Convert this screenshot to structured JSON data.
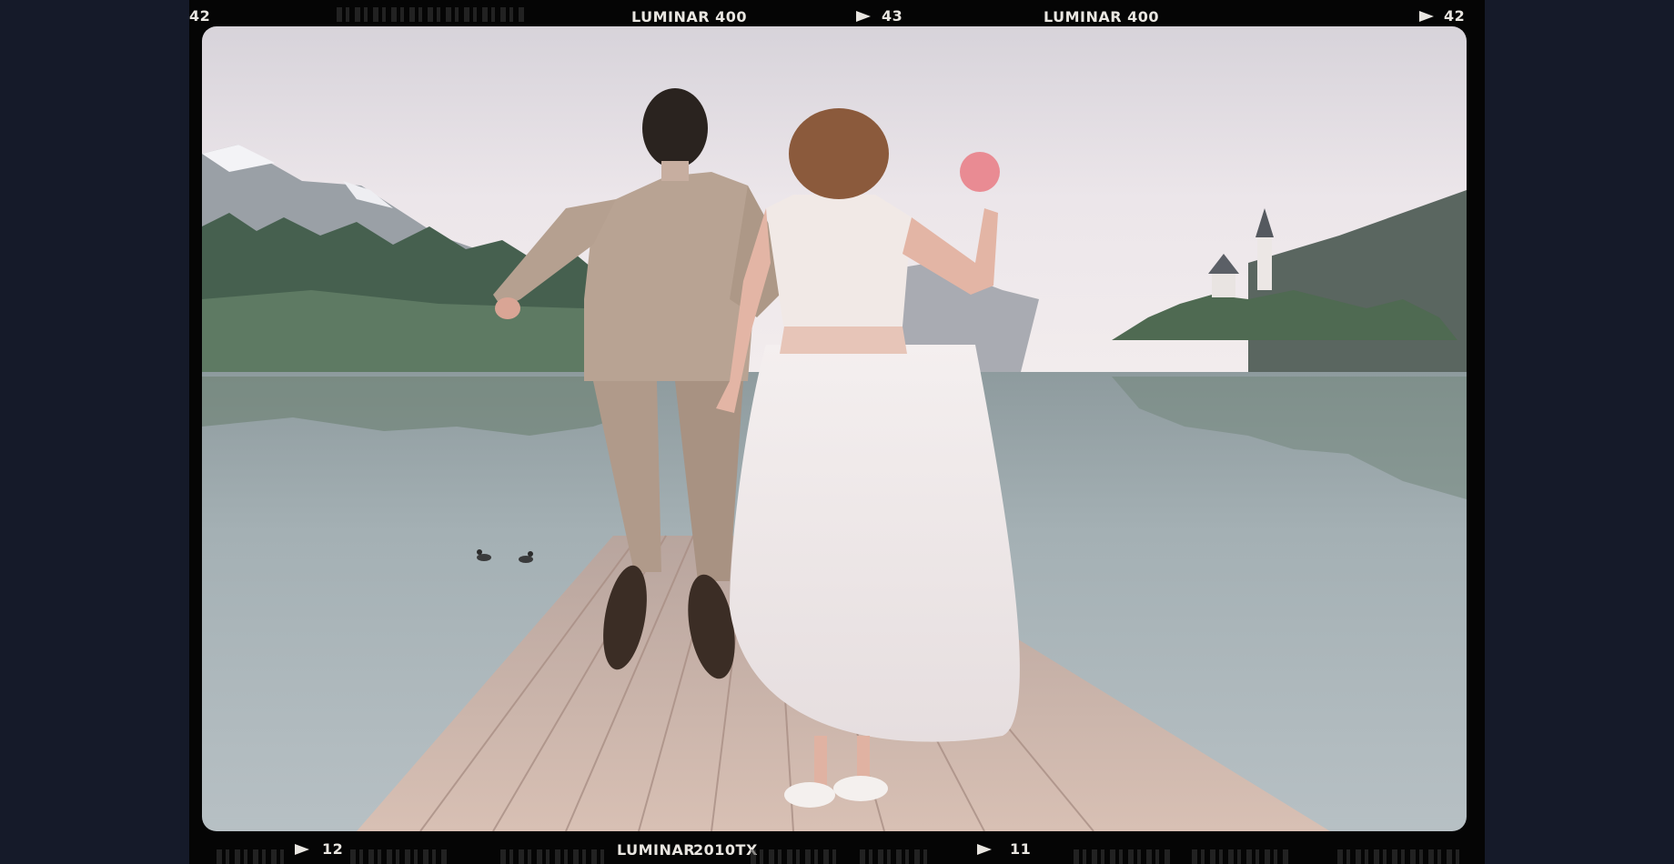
{
  "film_edge": {
    "top_frame_left": "42",
    "top_brand_1": "LUMINAR 400",
    "top_frame_mid": "43",
    "top_brand_2": "LUMINAR 400",
    "top_frame_right": "42",
    "bottom_frame_left": "12",
    "bottom_brand": "LUMINAR",
    "bottom_film_code": "2010TX",
    "bottom_frame_right": "11"
  },
  "photo": {
    "subject": "wedding-couple-jumping-on-pier",
    "colors": {
      "background": "#151a29",
      "film_border": "#050505",
      "edge_text": "#e9e6e1",
      "sky": "#e8e2e6",
      "lake": "#9aa7ac",
      "pier": "#c9b0a6"
    }
  }
}
